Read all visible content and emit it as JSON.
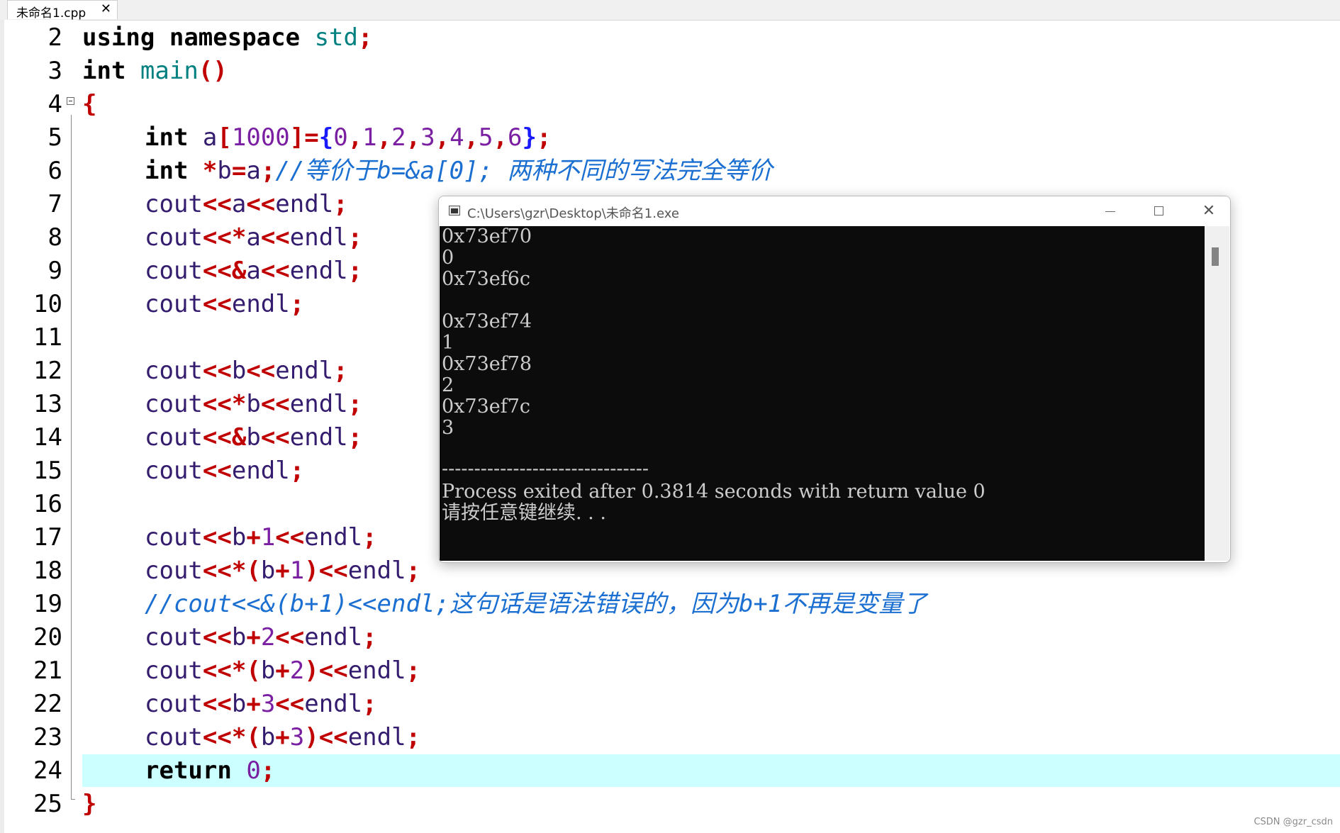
{
  "tab": {
    "label": "未命名1.cpp",
    "close_glyph": "✕"
  },
  "editor": {
    "lines": [
      {
        "n": "2"
      },
      {
        "n": "3"
      },
      {
        "n": "4"
      },
      {
        "n": "5"
      },
      {
        "n": "6"
      },
      {
        "n": "7"
      },
      {
        "n": "8"
      },
      {
        "n": "9"
      },
      {
        "n": "10"
      },
      {
        "n": "11"
      },
      {
        "n": "12"
      },
      {
        "n": "13"
      },
      {
        "n": "14"
      },
      {
        "n": "15"
      },
      {
        "n": "16"
      },
      {
        "n": "17"
      },
      {
        "n": "18"
      },
      {
        "n": "19"
      },
      {
        "n": "20"
      },
      {
        "n": "21"
      },
      {
        "n": "22"
      },
      {
        "n": "23"
      },
      {
        "n": "24"
      },
      {
        "n": "25"
      }
    ],
    "tokens": {
      "using": "using",
      "namespace": "namespace",
      "std": "std",
      "semi": ";",
      "int": "int",
      "main": "main",
      "parens": "()",
      "lbrace": "{",
      "rbrace": "}",
      "a": "a",
      "b": "b",
      "cout": "cout",
      "endl": "endl",
      "return": "return",
      "arr_decl_open": "[",
      "arr_size": "1000",
      "arr_decl_close": "]=",
      "arr_init_open": "{",
      "n0": "0",
      "n1": "1",
      "n2": "2",
      "n3": "3",
      "n4": "4",
      "n5": "5",
      "n6": "6",
      "comma": ",",
      "init_close": "}",
      "star": "*",
      "amp": "&",
      "eq": "=",
      "shl": "<<",
      "plus": "+",
      "lparen": "(",
      "rparen": ")"
    },
    "comment_line6": "//等价于b=&a[0]; 两种不同的写法完全等价",
    "comment_line19": "//cout<<&(b+1)<<endl;这句话是语法错误的，因为b+1不再是变量了"
  },
  "console": {
    "title": "C:\\Users\\gzr\\Desktop\\未命名1.exe",
    "close_glyph": "✕",
    "output": [
      "0x73ef70",
      "0",
      "0x73ef6c",
      "",
      "0x73ef74",
      "1",
      "0x73ef78",
      "2",
      "0x73ef7c",
      "3",
      "",
      "--------------------------------",
      "Process exited after 0.3814 seconds with return value 0",
      "请按任意键继续. . ."
    ]
  },
  "watermark": "CSDN @gzr_csdn",
  "colors": {
    "current_line_bg": "#ccffff",
    "operator": "#c00000",
    "comment": "#1b6fd1",
    "number": "#7a1fa2",
    "identifier": "#341c6e",
    "namespace": "#008080",
    "console_bg": "#0c0c0c",
    "console_text": "#cccccc"
  }
}
